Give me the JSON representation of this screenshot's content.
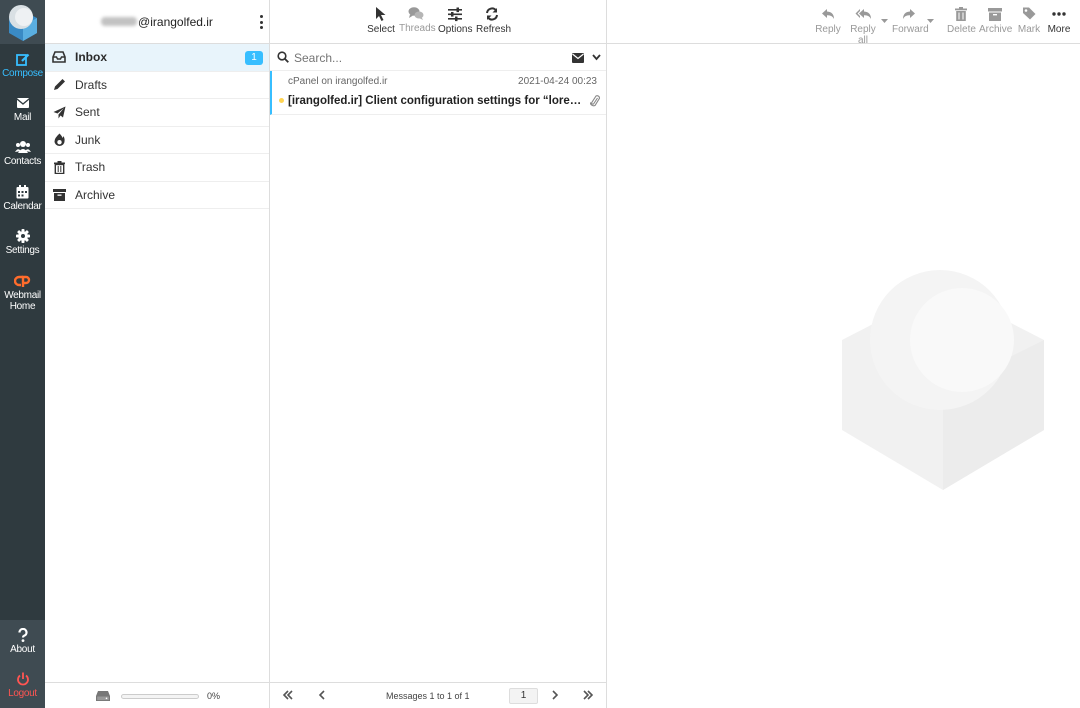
{
  "nav": {
    "items": [
      {
        "label": "Compose",
        "icon": "compose-icon"
      },
      {
        "label": "Mail",
        "icon": "mail-icon"
      },
      {
        "label": "Contacts",
        "icon": "contacts-icon"
      },
      {
        "label": "Calendar",
        "icon": "calendar-icon"
      },
      {
        "label": "Settings",
        "icon": "gear-icon"
      },
      {
        "label": "Webmail Home",
        "icon": "cpanel-icon"
      }
    ],
    "about_label": "About",
    "logout_label": "Logout"
  },
  "account": {
    "email_suffix": "@irangolfed.ir"
  },
  "folders": {
    "items": [
      {
        "label": "Inbox",
        "icon": "inbox-icon",
        "unread": "1"
      },
      {
        "label": "Drafts",
        "icon": "pencil-icon"
      },
      {
        "label": "Sent",
        "icon": "paper-plane-icon"
      },
      {
        "label": "Junk",
        "icon": "fire-icon"
      },
      {
        "label": "Trash",
        "icon": "trash-icon"
      },
      {
        "label": "Archive",
        "icon": "archive-icon"
      }
    ],
    "quota_percent": 0,
    "quota_text": "0%"
  },
  "list_toolbar": {
    "select_label": "Select",
    "threads_label": "Threads",
    "options_label": "Options",
    "refresh_label": "Refresh"
  },
  "search": {
    "placeholder": "Search..."
  },
  "messages": [
    {
      "from": "cPanel on irangolfed.ir",
      "date": "2021-04-24 00:23",
      "subject": "[irangolfed.ir] Client configuration settings for “lorestan@irangolfed.ir”.",
      "unread": true,
      "has_attachment": true
    }
  ],
  "pagination": {
    "count_text": "Messages 1 to 1 of 1",
    "page": "1"
  },
  "message_toolbar": {
    "reply_label": "Reply",
    "reply_all_label": "Reply all",
    "forward_label": "Forward",
    "delete_label": "Delete",
    "archive_label": "Archive",
    "mark_label": "Mark",
    "more_label": "More"
  },
  "colors": {
    "rail_bg": "#2f3a3f",
    "accent": "#37beff",
    "logout": "#ff5552",
    "unread_dot": "#ffd452",
    "cpanel": "#ff6c2c"
  }
}
